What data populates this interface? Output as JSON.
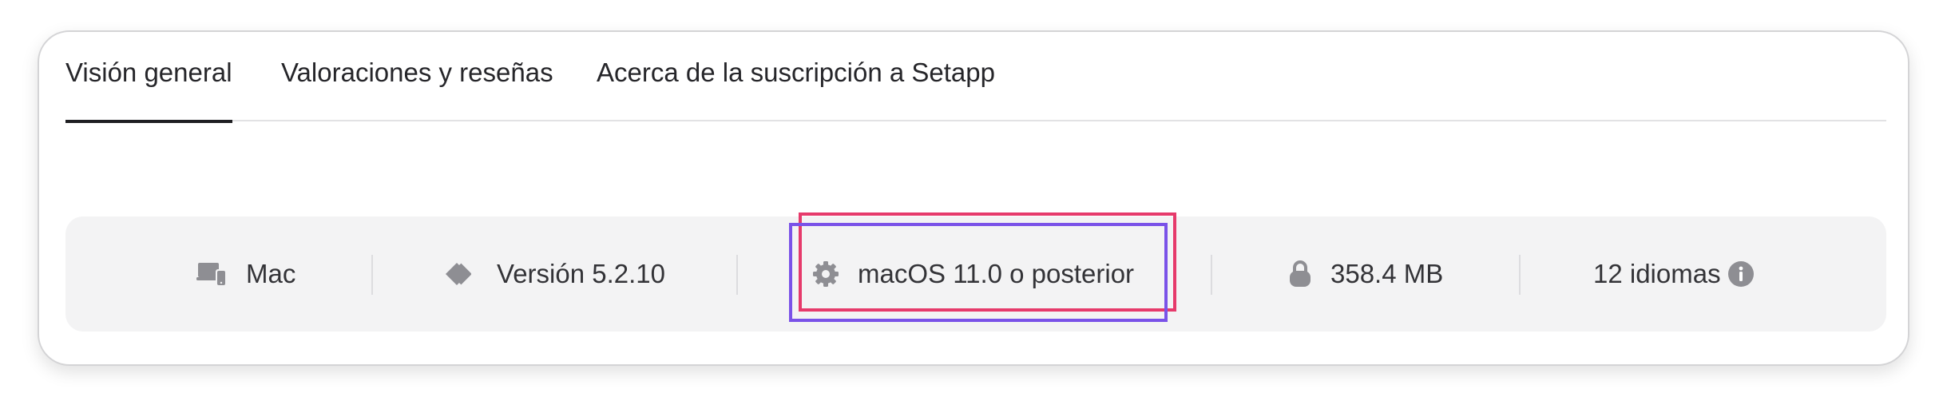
{
  "tabs": [
    {
      "label": "Visión general",
      "active": true
    },
    {
      "label": "Valoraciones y reseñas",
      "active": false
    },
    {
      "label": "Acerca de la suscripción a Setapp",
      "active": false
    }
  ],
  "info_bar": {
    "platform": {
      "label": "Mac",
      "icon": "devices-icon"
    },
    "version": {
      "label": "Versión 5.2.10",
      "icon": "version-tag-icon"
    },
    "requirements": {
      "label": "macOS 11.0 o posterior",
      "icon": "gear-icon"
    },
    "size": {
      "label": "358.4 MB",
      "icon": "lock-icon"
    },
    "languages": {
      "label": "12 idiomas",
      "icon": "info-icon"
    }
  },
  "colors": {
    "text": "#26262a",
    "bar_background": "#f3f3f4",
    "icon": "#8e8e93",
    "highlight_red": "#e63a6b",
    "highlight_purple": "#7a52e8"
  }
}
